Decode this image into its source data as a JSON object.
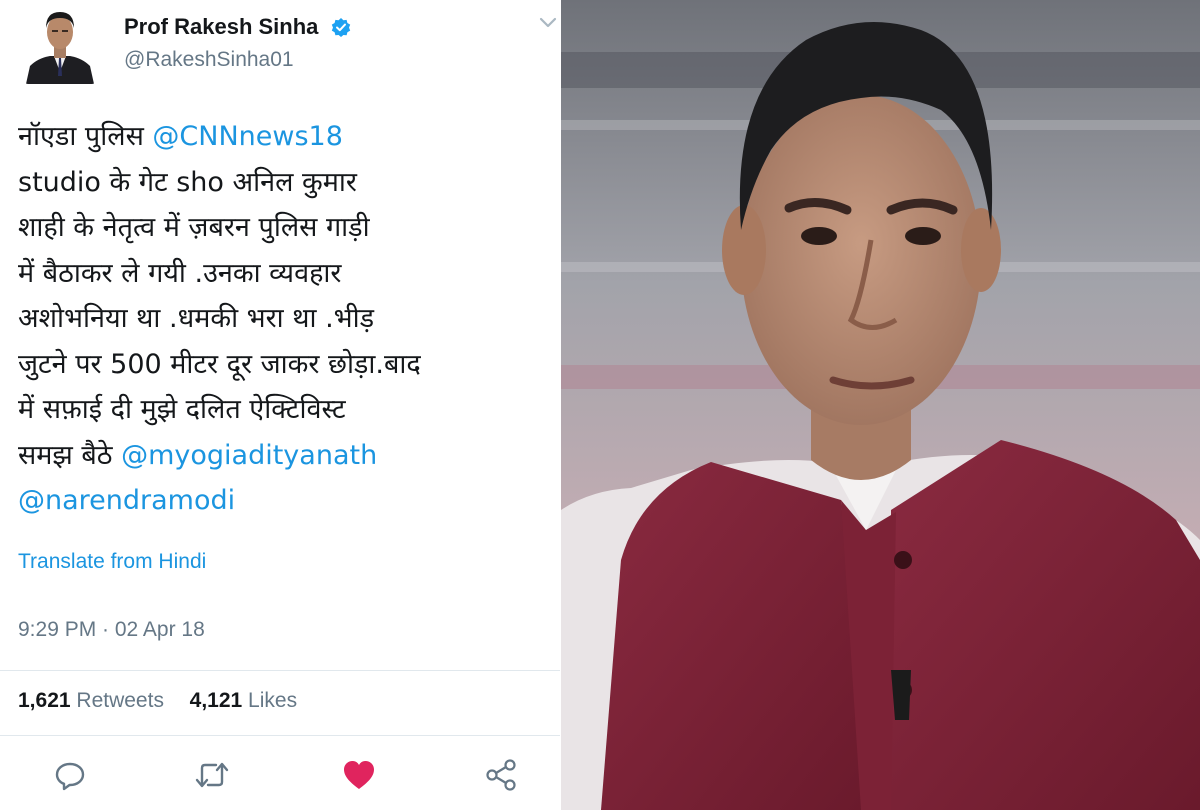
{
  "tweet": {
    "display_name": "Prof Rakesh Sinha",
    "handle": "@RakeshSinha01",
    "body_lines": [
      [
        {
          "text": "नॉएडा पुलिस  "
        },
        {
          "text": "@CNNnews18",
          "mention": true
        }
      ],
      [
        {
          "text": "studio के गेट sho अनिल कुमार"
        }
      ],
      [
        {
          "text": "शाही के नेतृत्व में ज़बरन पुलिस गाड़ी"
        }
      ],
      [
        {
          "text": "में बैठाकर ले गयी .उनका व्यवहार"
        }
      ],
      [
        {
          "text": "अशोभनिया था .धमकी भरा था .भीड़"
        }
      ],
      [
        {
          "text": "जुटने पर  500 मीटर दूर जाकर छोड़ा.बाद"
        }
      ],
      [
        {
          "text": "में सफ़ाई दी मुझे दलित ऐक्टिविस्ट"
        }
      ],
      [
        {
          "text": "समझ बैठे "
        },
        {
          "text": "@myogiadityanath",
          "mention": true
        }
      ],
      [
        {
          "text": "@narendramodi",
          "mention": true
        }
      ]
    ],
    "translate_label": "Translate from Hindi",
    "timestamp": "9:29 PM · 02 Apr 18",
    "retweets_count": "1,621",
    "retweets_label": "Retweets",
    "likes_count": "4,121",
    "likes_label": "Likes",
    "actions": [
      "reply-icon",
      "retweet-icon",
      "heart-icon",
      "share-icon"
    ]
  },
  "colors": {
    "link": "#1b95e0",
    "text": "#14171a",
    "secondary": "#657786",
    "like": "#e0245e",
    "jacket": "#7a1f33"
  }
}
